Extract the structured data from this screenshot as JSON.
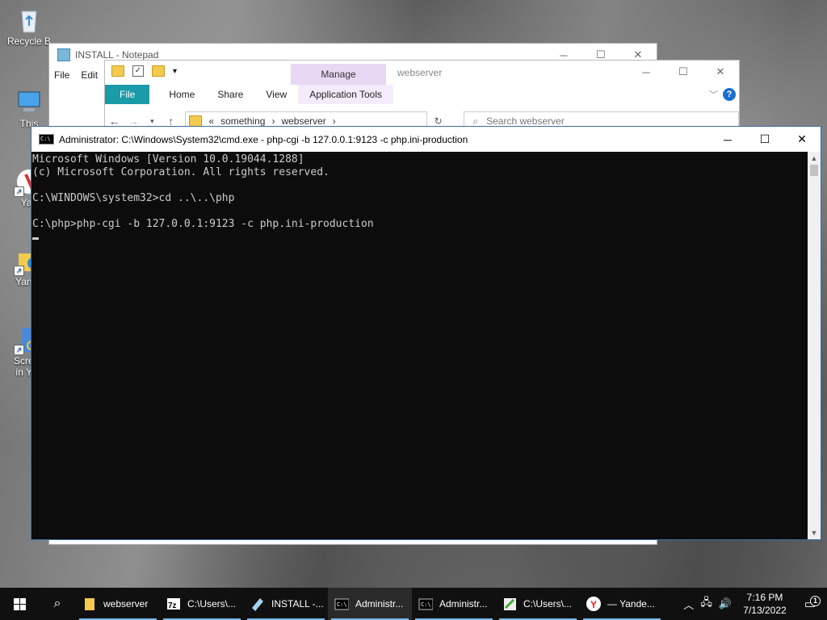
{
  "desktop": {
    "icons": [
      {
        "label": "Recycle B"
      },
      {
        "label": "This"
      },
      {
        "label": "Yan"
      },
      {
        "label": "Yande"
      },
      {
        "label": "Screen",
        "label2": "in Yan"
      }
    ]
  },
  "notepad": {
    "title": "INSTALL - Notepad",
    "menu": [
      "File",
      "Edit"
    ]
  },
  "explorer": {
    "window_title": "webserver",
    "manage_label": "Manage",
    "tabs": [
      "File",
      "Home",
      "Share",
      "View",
      "Application Tools"
    ],
    "breadcrumb": [
      "«",
      "something",
      "webserver"
    ],
    "search_placeholder": "Search webserver"
  },
  "cmd": {
    "title": "Administrator: C:\\Windows\\System32\\cmd.exe - php-cgi  -b 127.0.0.1:9123 -c php.ini-production",
    "lines": [
      "Microsoft Windows [Version 10.0.19044.1288]",
      "(c) Microsoft Corporation. All rights reserved.",
      "",
      "C:\\WINDOWS\\system32>cd ..\\..\\php",
      "",
      "C:\\php>php-cgi -b 127.0.0.1:9123 -c php.ini-production",
      ""
    ]
  },
  "taskbar": {
    "items": [
      {
        "label": "webserver",
        "icon": "folder-icon"
      },
      {
        "label": "C:\\Users\\...",
        "icon": "7zip-icon"
      },
      {
        "label": "INSTALL -...",
        "icon": "notepad-icon"
      },
      {
        "label": "Administr...",
        "icon": "cmd-icon",
        "active": true
      },
      {
        "label": "Administr...",
        "icon": "cmd-icon"
      },
      {
        "label": "C:\\Users\\...",
        "icon": "installer-icon"
      },
      {
        "label": "— Yande...",
        "icon": "yandex-icon"
      }
    ],
    "time": "7:16 PM",
    "date": "7/13/2022",
    "notification_count": "1"
  }
}
